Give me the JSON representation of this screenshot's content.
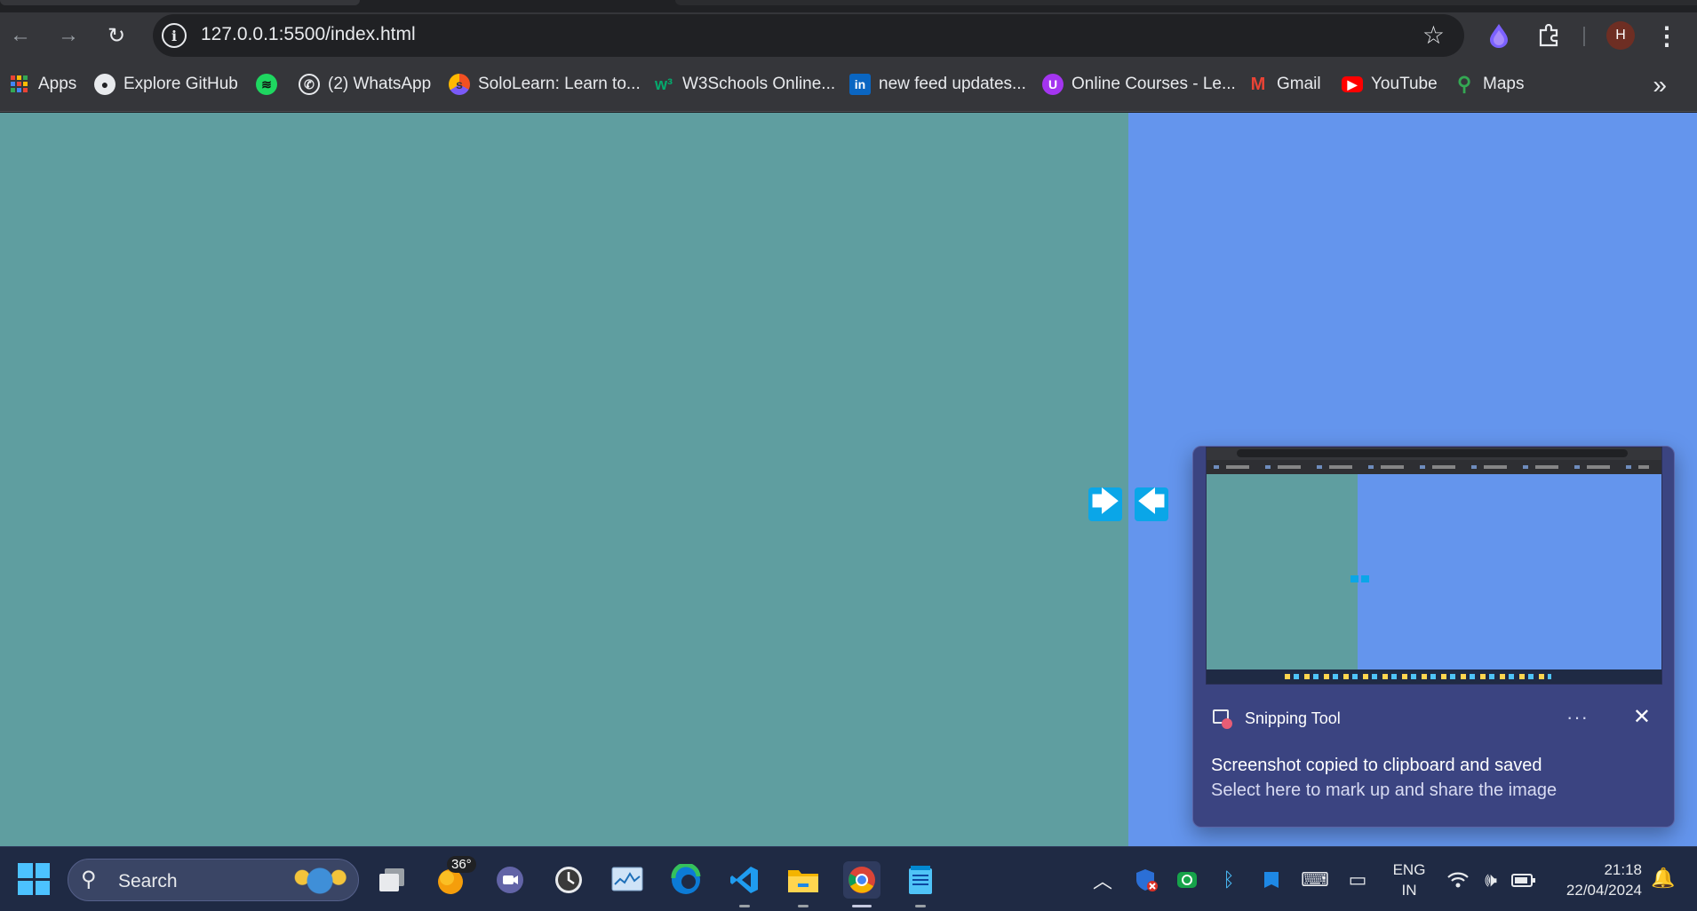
{
  "browser": {
    "url": "127.0.0.1:5500/index.html",
    "profile_initial": "H",
    "bookmarks": [
      {
        "label": "Apps",
        "icon": "apps-grid-icon"
      },
      {
        "label": "Explore GitHub",
        "icon": "github-icon"
      },
      {
        "label": "",
        "icon": "spotify-icon"
      },
      {
        "label": "(2) WhatsApp",
        "icon": "whatsapp-icon"
      },
      {
        "label": "SoloLearn: Learn to...",
        "icon": "sololearn-icon"
      },
      {
        "label": "W3Schools Online...",
        "icon": "w3schools-icon"
      },
      {
        "label": "new feed updates...",
        "icon": "linkedin-icon"
      },
      {
        "label": "Online Courses - Le...",
        "icon": "udemy-icon"
      },
      {
        "label": "Gmail",
        "icon": "gmail-icon"
      },
      {
        "label": "YouTube",
        "icon": "youtube-icon"
      },
      {
        "label": "Maps",
        "icon": "maps-icon"
      }
    ]
  },
  "page": {
    "left_color": "#5f9ea0",
    "right_color": "#6495ed",
    "button_color": "#0aa6e8",
    "arrow_right": "🡆",
    "arrow_left": "🡄"
  },
  "toast": {
    "app_name": "Snipping Tool",
    "more": "···",
    "title": "Screenshot copied to clipboard and saved",
    "body": "Select here to mark up and share the image"
  },
  "taskbar": {
    "search_label": "Search",
    "weather_badge": "36°",
    "language_line1": "ENG",
    "language_line2": "IN",
    "time": "21:18",
    "date": "22/04/2024"
  }
}
